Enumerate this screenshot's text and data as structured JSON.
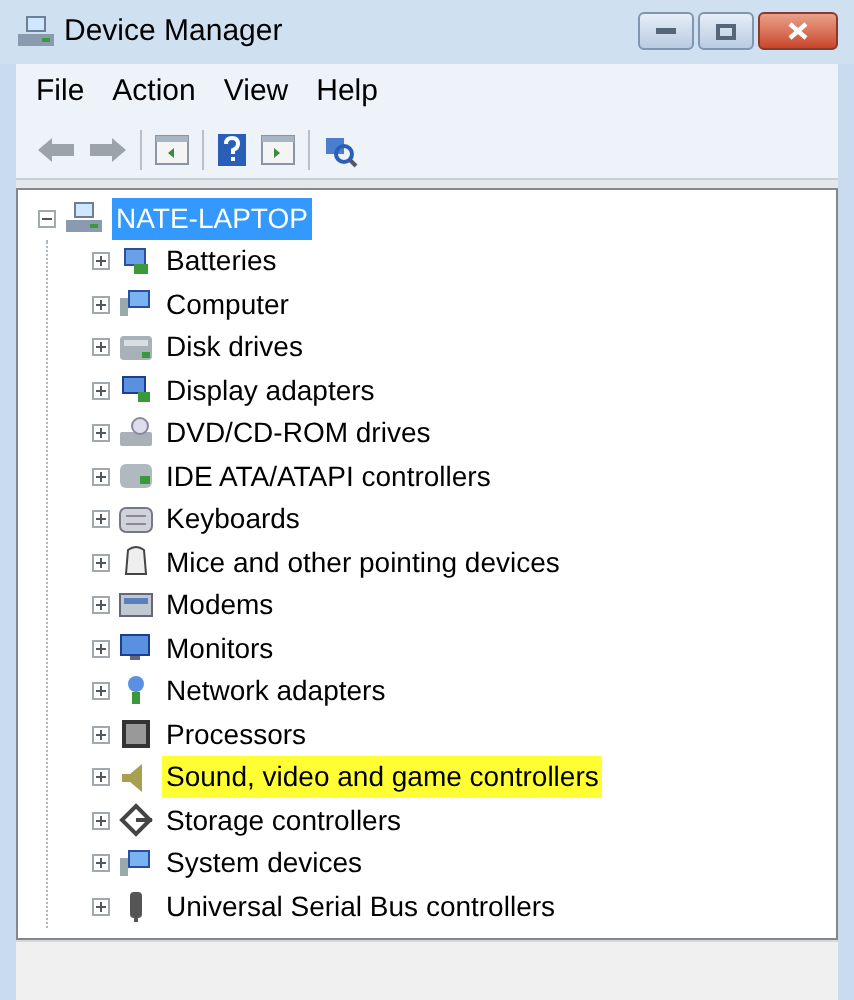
{
  "window": {
    "title": "Device Manager"
  },
  "menu": [
    {
      "label": "File"
    },
    {
      "label": "Action"
    },
    {
      "label": "View"
    },
    {
      "label": "Help"
    }
  ],
  "tree": {
    "label": "NATE-LAPTOP",
    "selected": true,
    "expanded": true,
    "children": [
      {
        "label": "Batteries",
        "expanded": false,
        "highlighted": false
      },
      {
        "label": "Computer",
        "expanded": false,
        "highlighted": false
      },
      {
        "label": "Disk drives",
        "expanded": false,
        "highlighted": false
      },
      {
        "label": "Display adapters",
        "expanded": false,
        "highlighted": false
      },
      {
        "label": "DVD/CD-ROM drives",
        "expanded": false,
        "highlighted": false
      },
      {
        "label": "IDE ATA/ATAPI controllers",
        "expanded": false,
        "highlighted": false
      },
      {
        "label": "Keyboards",
        "expanded": false,
        "highlighted": false
      },
      {
        "label": "Mice and other pointing devices",
        "expanded": false,
        "highlighted": false
      },
      {
        "label": "Modems",
        "expanded": false,
        "highlighted": false
      },
      {
        "label": "Monitors",
        "expanded": false,
        "highlighted": false
      },
      {
        "label": "Network adapters",
        "expanded": false,
        "highlighted": false
      },
      {
        "label": "Processors",
        "expanded": false,
        "highlighted": false
      },
      {
        "label": "Sound, video and game controllers",
        "expanded": false,
        "highlighted": true
      },
      {
        "label": "Storage controllers",
        "expanded": false,
        "highlighted": false
      },
      {
        "label": "System devices",
        "expanded": false,
        "highlighted": false
      },
      {
        "label": "Universal Serial Bus controllers",
        "expanded": false,
        "highlighted": false
      }
    ]
  }
}
